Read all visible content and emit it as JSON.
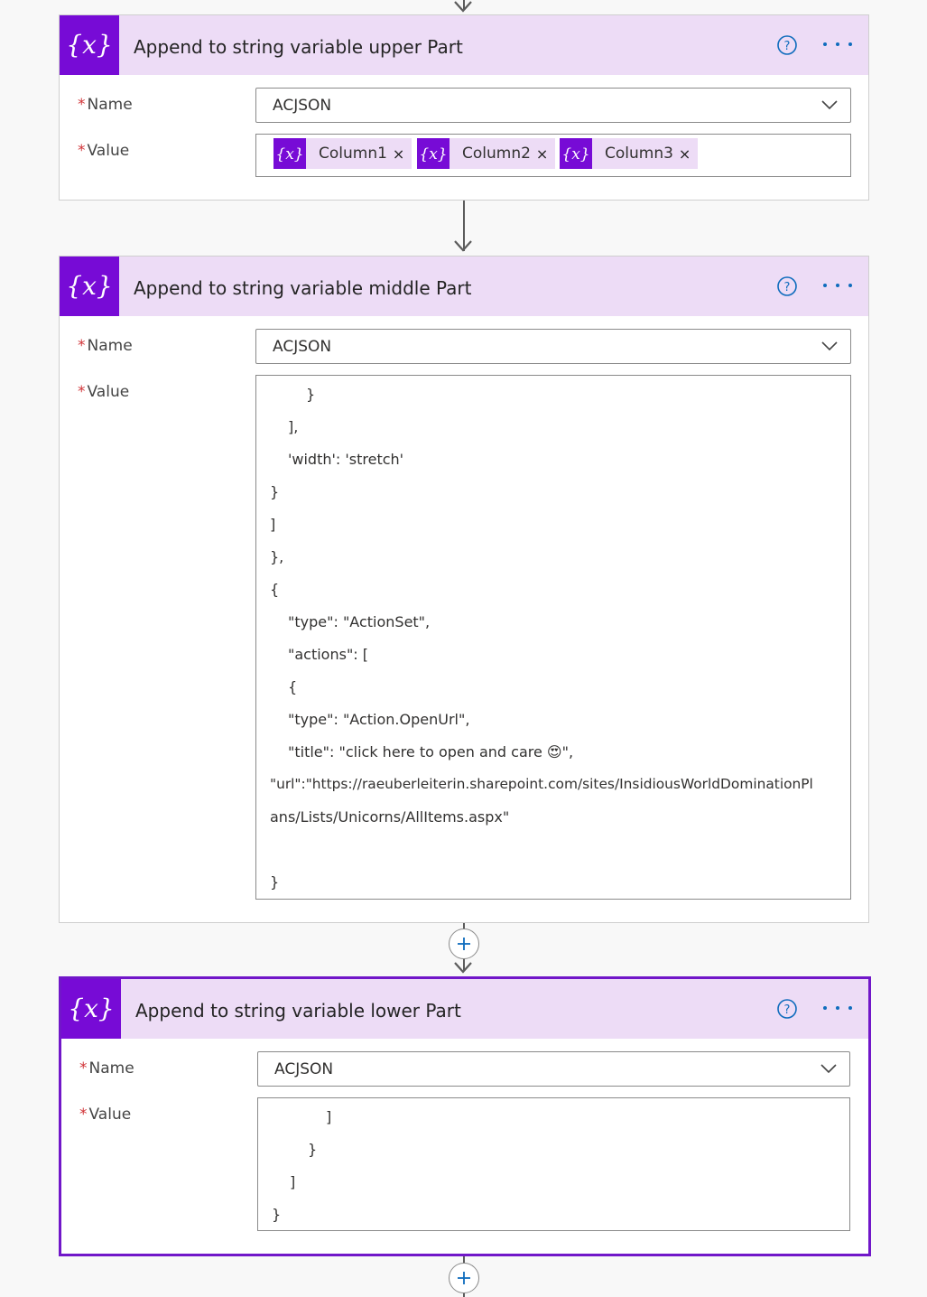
{
  "cards": [
    {
      "title": "Append to string variable upper Part",
      "name_label": "Name",
      "name_value": "ACJSON",
      "value_label": "Value",
      "tokens": [
        {
          "label": "Column1",
          "close": "×"
        },
        {
          "label": "Column2",
          "close": "×"
        },
        {
          "label": "Column3",
          "close": "×"
        }
      ]
    },
    {
      "title": "Append to string variable middle Part",
      "name_label": "Name",
      "name_value": "ACJSON",
      "value_label": "Value",
      "code_lines": [
        "}",
        "],",
        "'width': 'stretch'",
        "}",
        "]",
        "},",
        "{",
        "\"type\": \"ActionSet\",",
        "\"actions\": [",
        "{",
        "\"type\": \"Action.OpenUrl\",",
        "\"title\": \"click here to open and care 😍\",",
        "\"url\":\"https://raeuberleiterin.sharepoint.com/sites/InsidiousWorldDominationPl",
        "ans/Lists/Unicorns/AllItems.aspx\"",
        "}"
      ]
    },
    {
      "title": "Append to string variable lower Part",
      "name_label": "Name",
      "name_value": "ACJSON",
      "value_label": "Value",
      "code_lines": [
        "]",
        "}",
        "]",
        "}"
      ]
    }
  ],
  "icons": {
    "variable": "variable-icon",
    "help": "help-icon",
    "more": "more-icon",
    "chevron": "chevron-down-icon",
    "add": "add-step-icon",
    "close": "close-icon"
  },
  "colors": {
    "accent": "#770bd6",
    "header_bg": "#eddcf6",
    "selected_border": "#7117c9",
    "link_blue": "#0f6cbd",
    "required": "#d13438"
  }
}
